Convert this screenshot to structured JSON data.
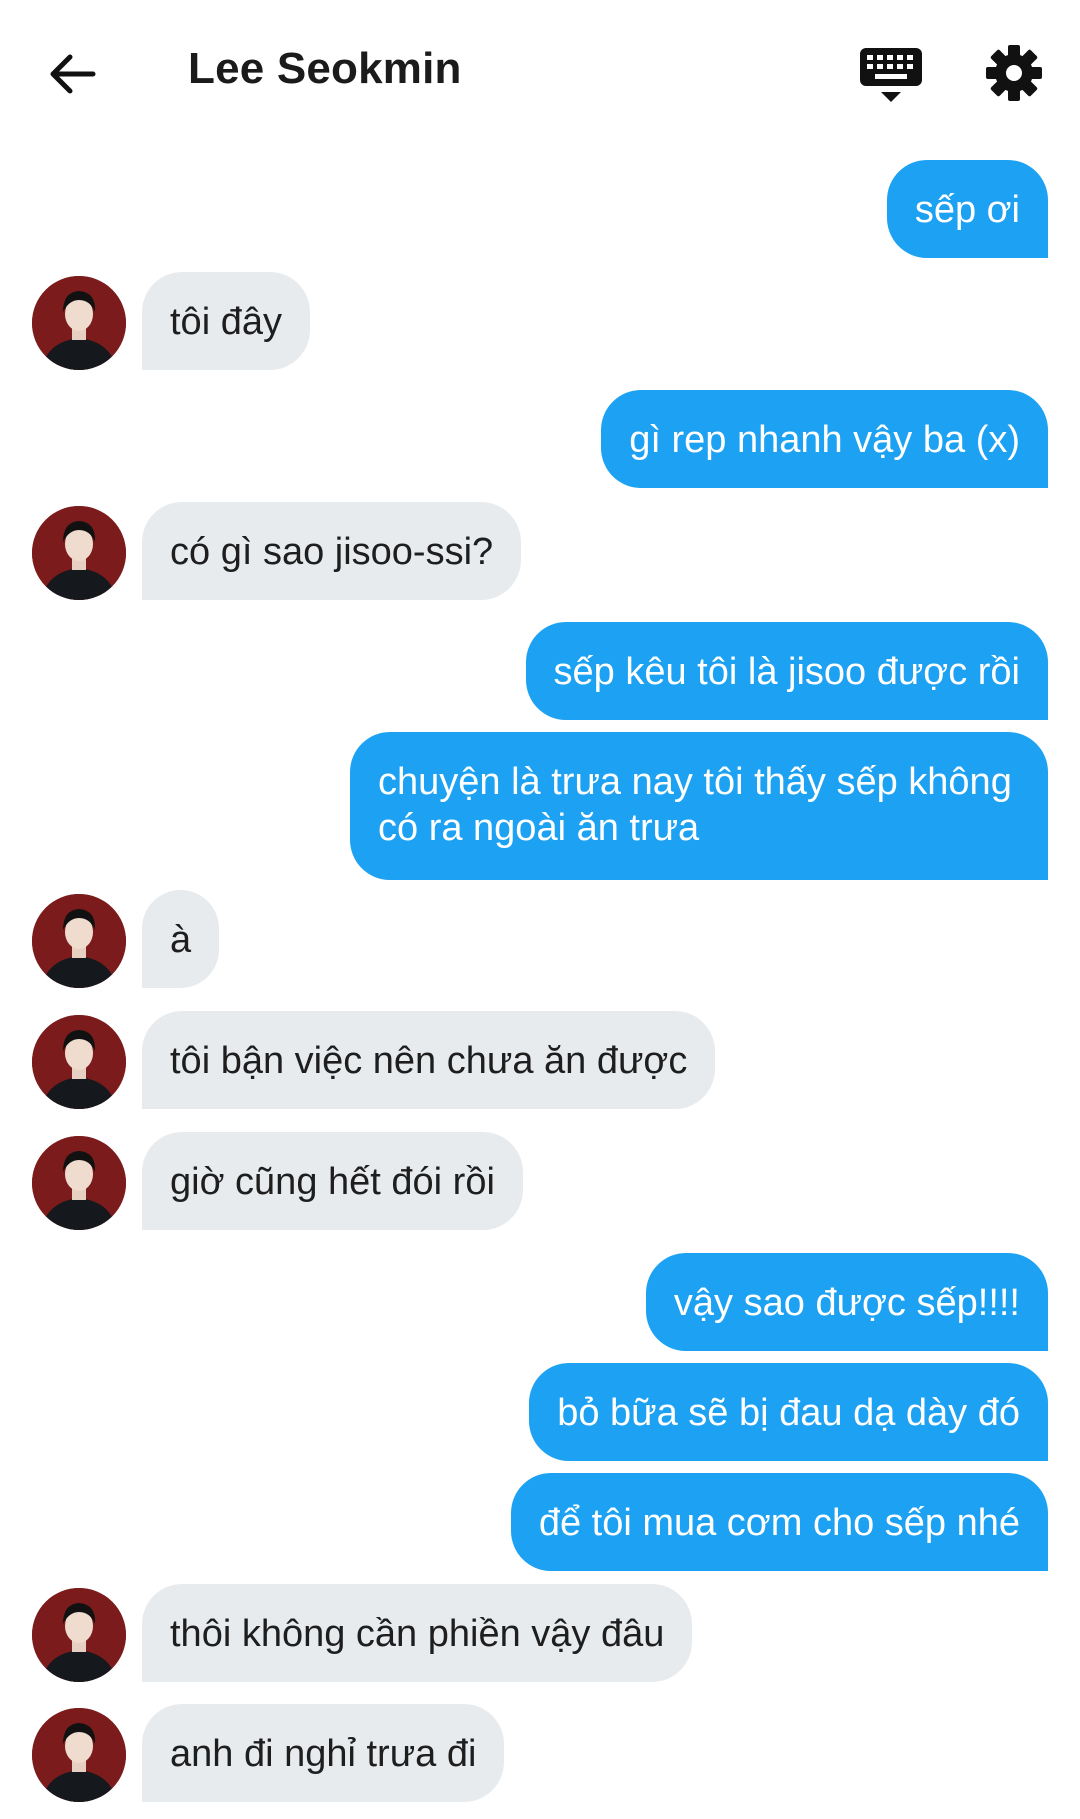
{
  "header": {
    "title": "Lee Seokmin"
  },
  "icons": {
    "back": "arrow-left-icon",
    "keyboard": "keyboard-icon",
    "settings": "gear-icon"
  },
  "colors": {
    "outgoing_bubble": "#1da1f2",
    "incoming_bubble": "#e8ebee"
  },
  "messages": [
    {
      "side": "out",
      "text": "sếp ơi"
    },
    {
      "side": "in",
      "text": "tôi đây"
    },
    {
      "side": "out",
      "text": "gì rep nhanh vậy ba (x)"
    },
    {
      "side": "in",
      "text": "có gì sao jisoo-ssi?"
    },
    {
      "side": "out",
      "text": "sếp kêu tôi là jisoo được rồi"
    },
    {
      "side": "out",
      "text": "chuyện là trưa nay tôi thấy sếp không có ra ngoài ăn trưa"
    },
    {
      "side": "in",
      "text": "à"
    },
    {
      "side": "in",
      "text": "tôi bận việc nên chưa ăn được"
    },
    {
      "side": "in",
      "text": "giờ cũng hết đói rồi"
    },
    {
      "side": "out",
      "text": "vậy sao được sếp!!!!"
    },
    {
      "side": "out",
      "text": "bỏ bữa sẽ bị đau dạ dày đó"
    },
    {
      "side": "out",
      "text": "để tôi mua cơm cho sếp nhé"
    },
    {
      "side": "in",
      "text": "thôi không cần phiền vậy đâu"
    },
    {
      "side": "in",
      "text": "anh đi nghỉ trưa đi"
    }
  ]
}
